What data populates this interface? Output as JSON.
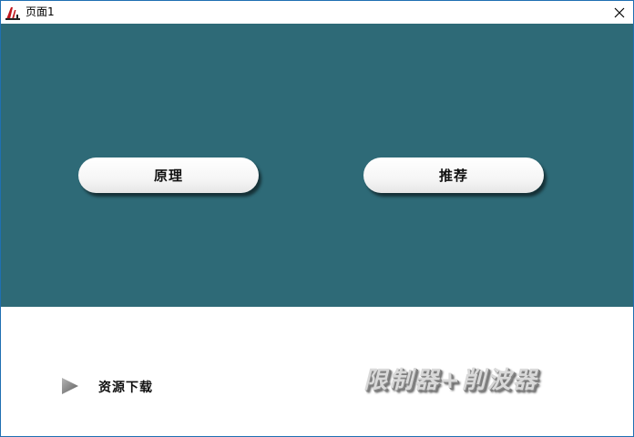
{
  "window": {
    "title": "页面1"
  },
  "icons": {
    "app": "app-logo-icon",
    "close": "close-icon",
    "play": "play-triangle-icon"
  },
  "colors": {
    "panel_top": "#2e6a77",
    "panel_bottom": "#ffffff",
    "border": "#1f6fb2"
  },
  "main": {
    "principle_label": "原理",
    "recommend_label": "推荐"
  },
  "footer": {
    "download_label": "资源下载",
    "banner_text": "限制器+削波器"
  }
}
